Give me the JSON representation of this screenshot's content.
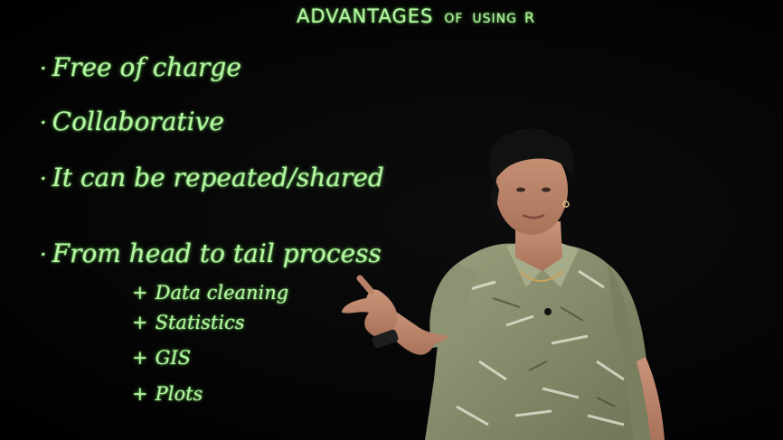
{
  "board": {
    "title": {
      "main": "ADVANTAGES",
      "of": "OF",
      "using": "USING",
      "r": "R"
    },
    "bullets": [
      {
        "dot": "·",
        "text": "Free of charge"
      },
      {
        "dot": "·",
        "text": "Collaborative"
      },
      {
        "dot": "·",
        "text": "It can be repeated/shared"
      },
      {
        "dot": "·",
        "text": "From head to tail process"
      }
    ],
    "subitems": [
      {
        "plus": "+",
        "text": "Data cleaning"
      },
      {
        "plus": "+",
        "text": "Statistics"
      },
      {
        "plus": "+",
        "text": "GIS"
      },
      {
        "plus": "+",
        "text": "Plots"
      }
    ]
  },
  "colors": {
    "chalk": "#b6f7a4",
    "background": "#050505",
    "shirt": "#8a8f6e"
  }
}
